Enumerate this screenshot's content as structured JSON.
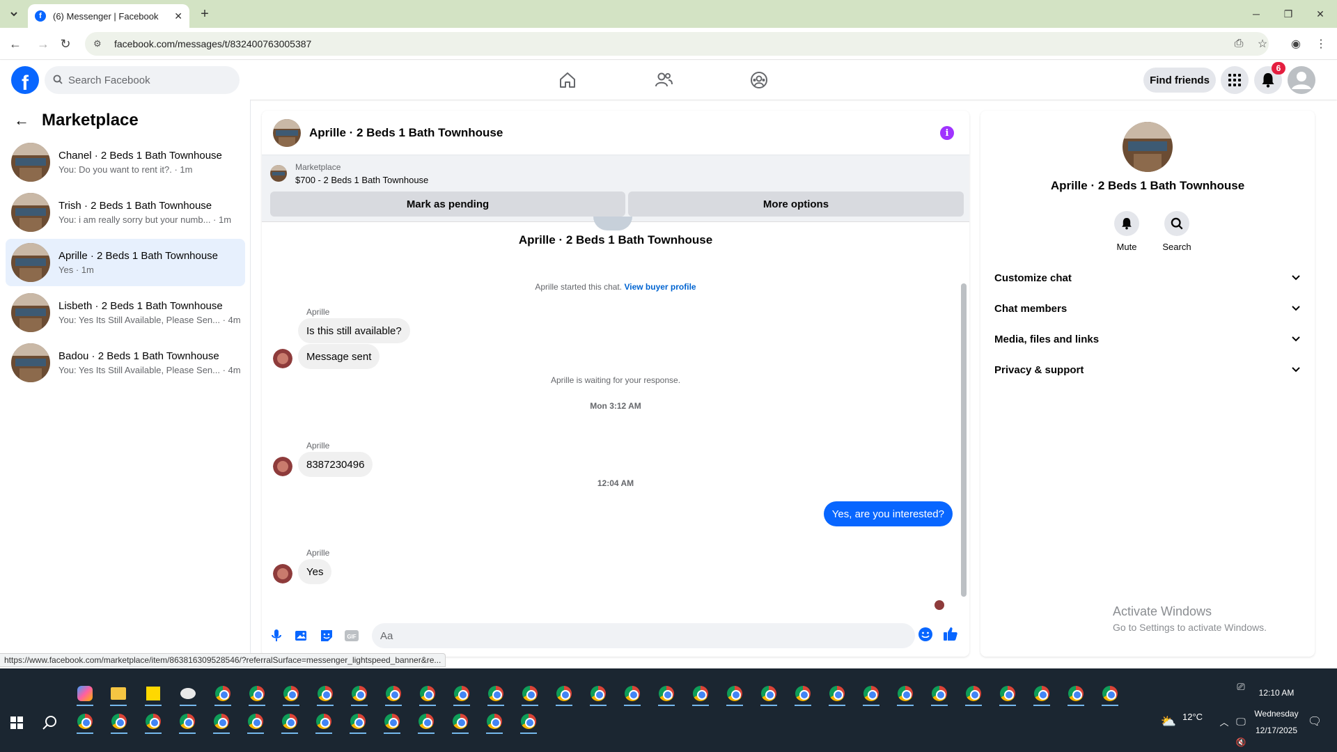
{
  "browser": {
    "tab_title": "(6) Messenger | Facebook",
    "url": "facebook.com/messages/t/832400763005387",
    "status_url": "https://www.facebook.com/marketplace/item/863816309528546/?referralSurface=messenger_lightspeed_banner&re..."
  },
  "fb_header": {
    "search_placeholder": "Search Facebook",
    "find_friends_label": "Find friends",
    "notification_count": "6"
  },
  "sidebar": {
    "title": "Marketplace",
    "conversations": [
      {
        "name": "Chanel · 2 Beds 1 Bath Townhouse",
        "snippet": "You: Do you want to rent it?. · 1m",
        "active": false
      },
      {
        "name": "Trish · 2 Beds 1 Bath Townhouse",
        "snippet": "You: i am really sorry but your numb... · 1m",
        "active": false
      },
      {
        "name": "Aprille · 2 Beds 1 Bath Townhouse",
        "snippet": "Yes · 1m",
        "active": true
      },
      {
        "name": "Lisbeth · 2 Beds 1 Bath Townhouse",
        "snippet": "You: Yes Its Still Available, Please Sen... · 4m",
        "active": false
      },
      {
        "name": "Badou · 2 Beds 1 Bath Townhouse",
        "snippet": "You: Yes Its Still Available, Please Sen... · 4m",
        "active": false
      }
    ]
  },
  "chat": {
    "title": "Aprille · 2 Beds 1 Bath Townhouse",
    "marketplace_label": "Marketplace",
    "marketplace_item": "$700 - 2 Beds 1 Bath Townhouse",
    "mark_pending_label": "Mark as pending",
    "more_options_label": "More options",
    "intro_name": "Aprille · 2 Beds 1 Bath Townhouse",
    "started_text": "Aprille started this chat.",
    "view_profile_link": "View buyer profile",
    "sender_name": "Aprille",
    "msg_1": "Is this still available?",
    "msg_2": "Message sent",
    "waiting_text": "Aprille is waiting for your response.",
    "time_1": "Mon 3:12 AM",
    "msg_3": "8387230496",
    "time_2": "12:04 AM",
    "msg_out": "Yes, are you interested?",
    "msg_4": "Yes",
    "composer_placeholder": "Aa"
  },
  "info_panel": {
    "name": "Aprille · 2 Beds 1 Bath Townhouse",
    "mute_label": "Mute",
    "search_label": "Search",
    "rows": [
      "Customize chat",
      "Chat members",
      "Media, files and links",
      "Privacy & support"
    ]
  },
  "watermark": {
    "line1": "Activate Windows",
    "line2": "Go to Settings to activate Windows."
  },
  "taskbar": {
    "weather": "12°C",
    "time": "12:10 AM",
    "day": "Wednesday",
    "date": "12/17/2025"
  },
  "colors": {
    "fb_blue": "#0866ff",
    "active_conv_bg": "#e7f0fd",
    "badge_red": "#e41e3f",
    "info_purple": "#a033ff"
  }
}
